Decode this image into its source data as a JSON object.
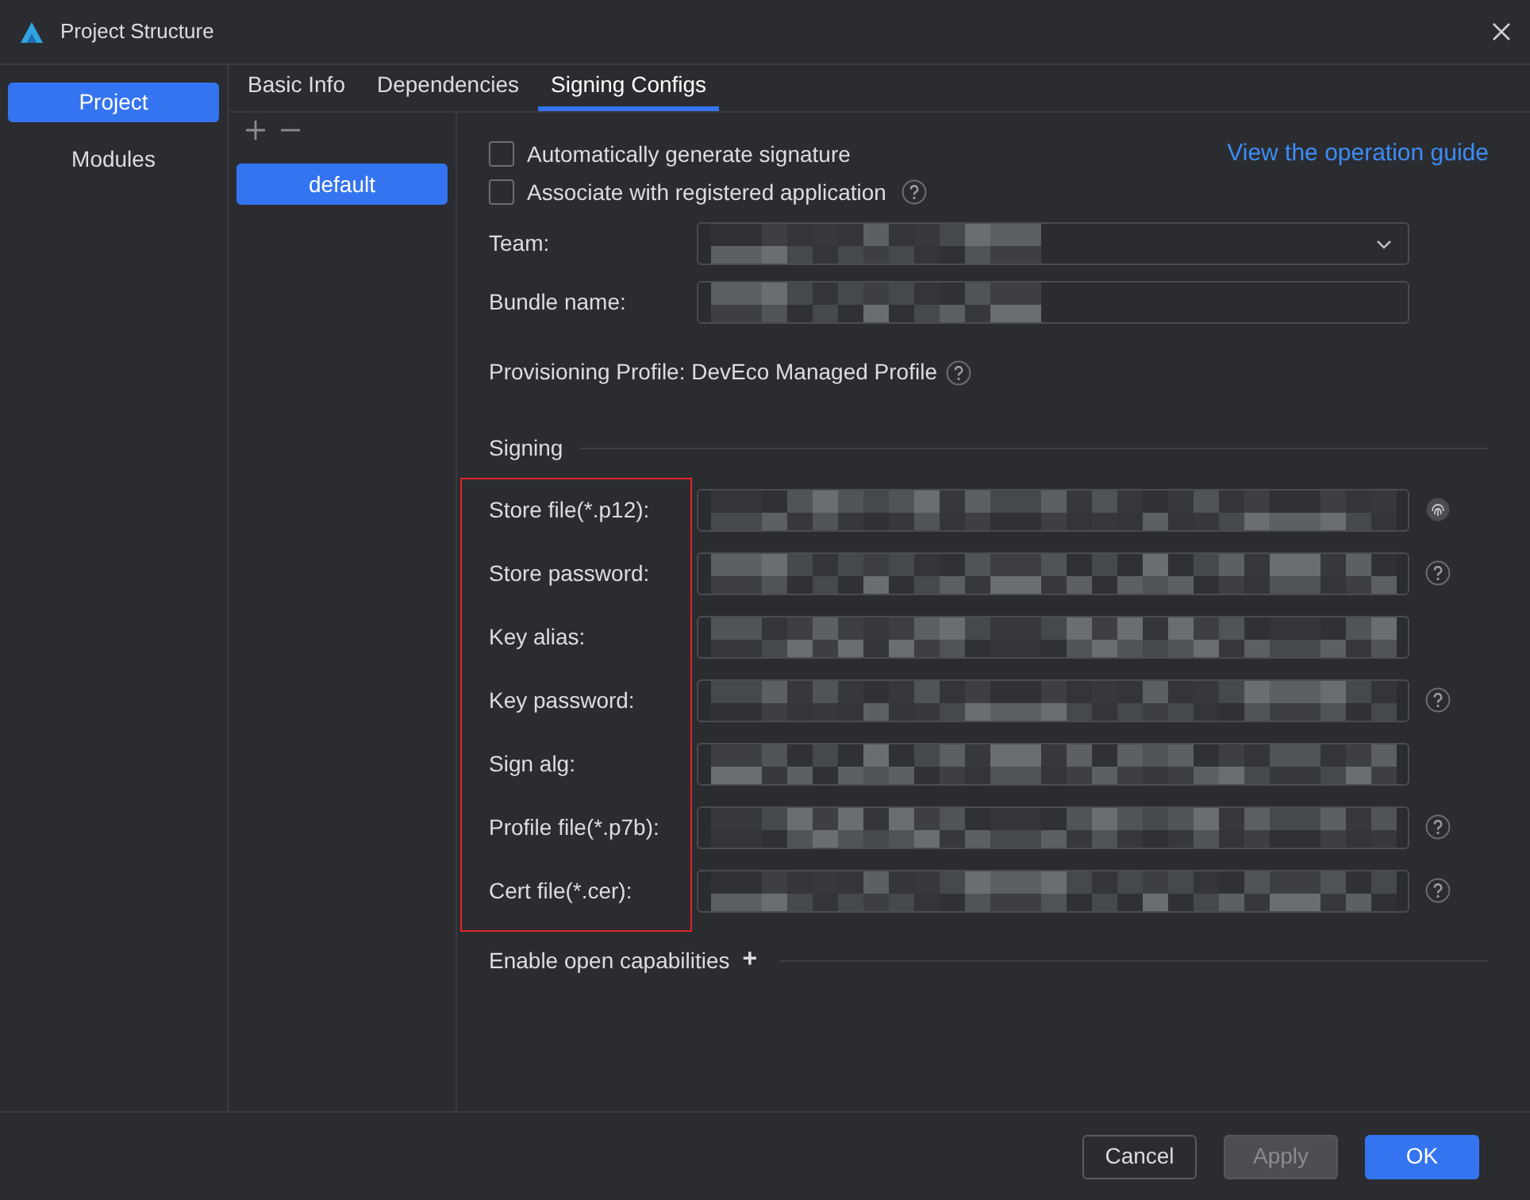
{
  "window": {
    "title": "Project Structure"
  },
  "sidebar": {
    "items": [
      {
        "label": "Project",
        "selected": true
      },
      {
        "label": "Modules",
        "selected": false
      }
    ]
  },
  "tabs": [
    {
      "label": "Basic Info",
      "selected": false
    },
    {
      "label": "Dependencies",
      "selected": false
    },
    {
      "label": "Signing Configs",
      "selected": true
    }
  ],
  "configs": {
    "items": [
      {
        "label": "default",
        "selected": true
      }
    ]
  },
  "options": [
    {
      "label": "Automatically generate signature",
      "checked": false,
      "help": false
    },
    {
      "label": "Associate with registered application",
      "checked": false,
      "help": true
    }
  ],
  "guide_link": "View the operation guide",
  "app_fields": [
    {
      "label": "Team:",
      "kind": "dropdown",
      "redacted": true
    },
    {
      "label": "Bundle name:",
      "kind": "text",
      "redacted": true
    }
  ],
  "provisioning": {
    "label": "Provisioning Profile: DevEco Managed Profile",
    "help": true
  },
  "signing": {
    "title": "Signing",
    "highlighted": true,
    "fields": [
      {
        "label": "Store file(*.p12):",
        "redacted": true,
        "fingerprint": true,
        "help": false
      },
      {
        "label": "Store password:",
        "redacted": true,
        "fingerprint": false,
        "help": true
      },
      {
        "label": "Key alias:",
        "redacted": true,
        "fingerprint": false,
        "help": false
      },
      {
        "label": "Key password:",
        "redacted": true,
        "fingerprint": false,
        "help": true
      },
      {
        "label": "Sign alg:",
        "redacted": true,
        "fingerprint": false,
        "help": false
      },
      {
        "label": "Profile file(*.p7b):",
        "redacted": true,
        "fingerprint": false,
        "help": true
      },
      {
        "label": "Cert file(*.cer):",
        "redacted": true,
        "fingerprint": false,
        "help": true
      }
    ]
  },
  "capabilities": {
    "label": "Enable open capabilities",
    "add": "+"
  },
  "buttons": [
    {
      "label": "Cancel",
      "kind": "secondary",
      "disabled": false
    },
    {
      "label": "Apply",
      "kind": "secondary",
      "disabled": true
    },
    {
      "label": "OK",
      "kind": "primary",
      "disabled": false
    }
  ]
}
